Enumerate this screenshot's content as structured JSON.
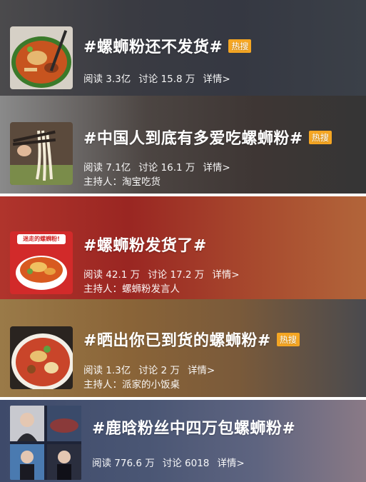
{
  "topics": [
    {
      "title": "#螺蛳粉还不发货#",
      "badge": "热搜",
      "reads": "阅读 3.3亿",
      "discussions": "讨论 15.8 万",
      "details": "详情>",
      "host": ""
    },
    {
      "title": "#中国人到底有多爱吃螺蛳粉#",
      "badge": "热搜",
      "reads": "阅读 7.1亿",
      "discussions": "讨论 16.1 万",
      "details": "详情>",
      "host": "主持人：淘宝吃货"
    },
    {
      "title": "#螺蛳粉发货了#",
      "badge": "",
      "reads": "阅读 42.1 万",
      "discussions": "讨论 17.2 万",
      "details": "详情>",
      "host": "主持人：螺蛳粉发言人",
      "thumb_caption": "迷走的螺蛳粉!"
    },
    {
      "title": "#晒出你已到货的螺蛳粉#",
      "badge": "热搜",
      "reads": "阅读 1.3亿",
      "discussions": "讨论 2 万",
      "details": "详情>",
      "host": "主持人：派家的小饭桌"
    },
    {
      "title": "#鹿晗粉丝中四万包螺蛳粉#",
      "badge": "",
      "reads": "阅读 776.6 万",
      "discussions": "讨论 6018",
      "details": "详情>",
      "host": ""
    }
  ],
  "colors": {
    "badge": "#f5a623",
    "card1": "#3a3d44",
    "card2": "#4a3f3a",
    "card3": "#9a2a24",
    "card4": "#8a6a3a",
    "card5": "#4a5a7a"
  }
}
